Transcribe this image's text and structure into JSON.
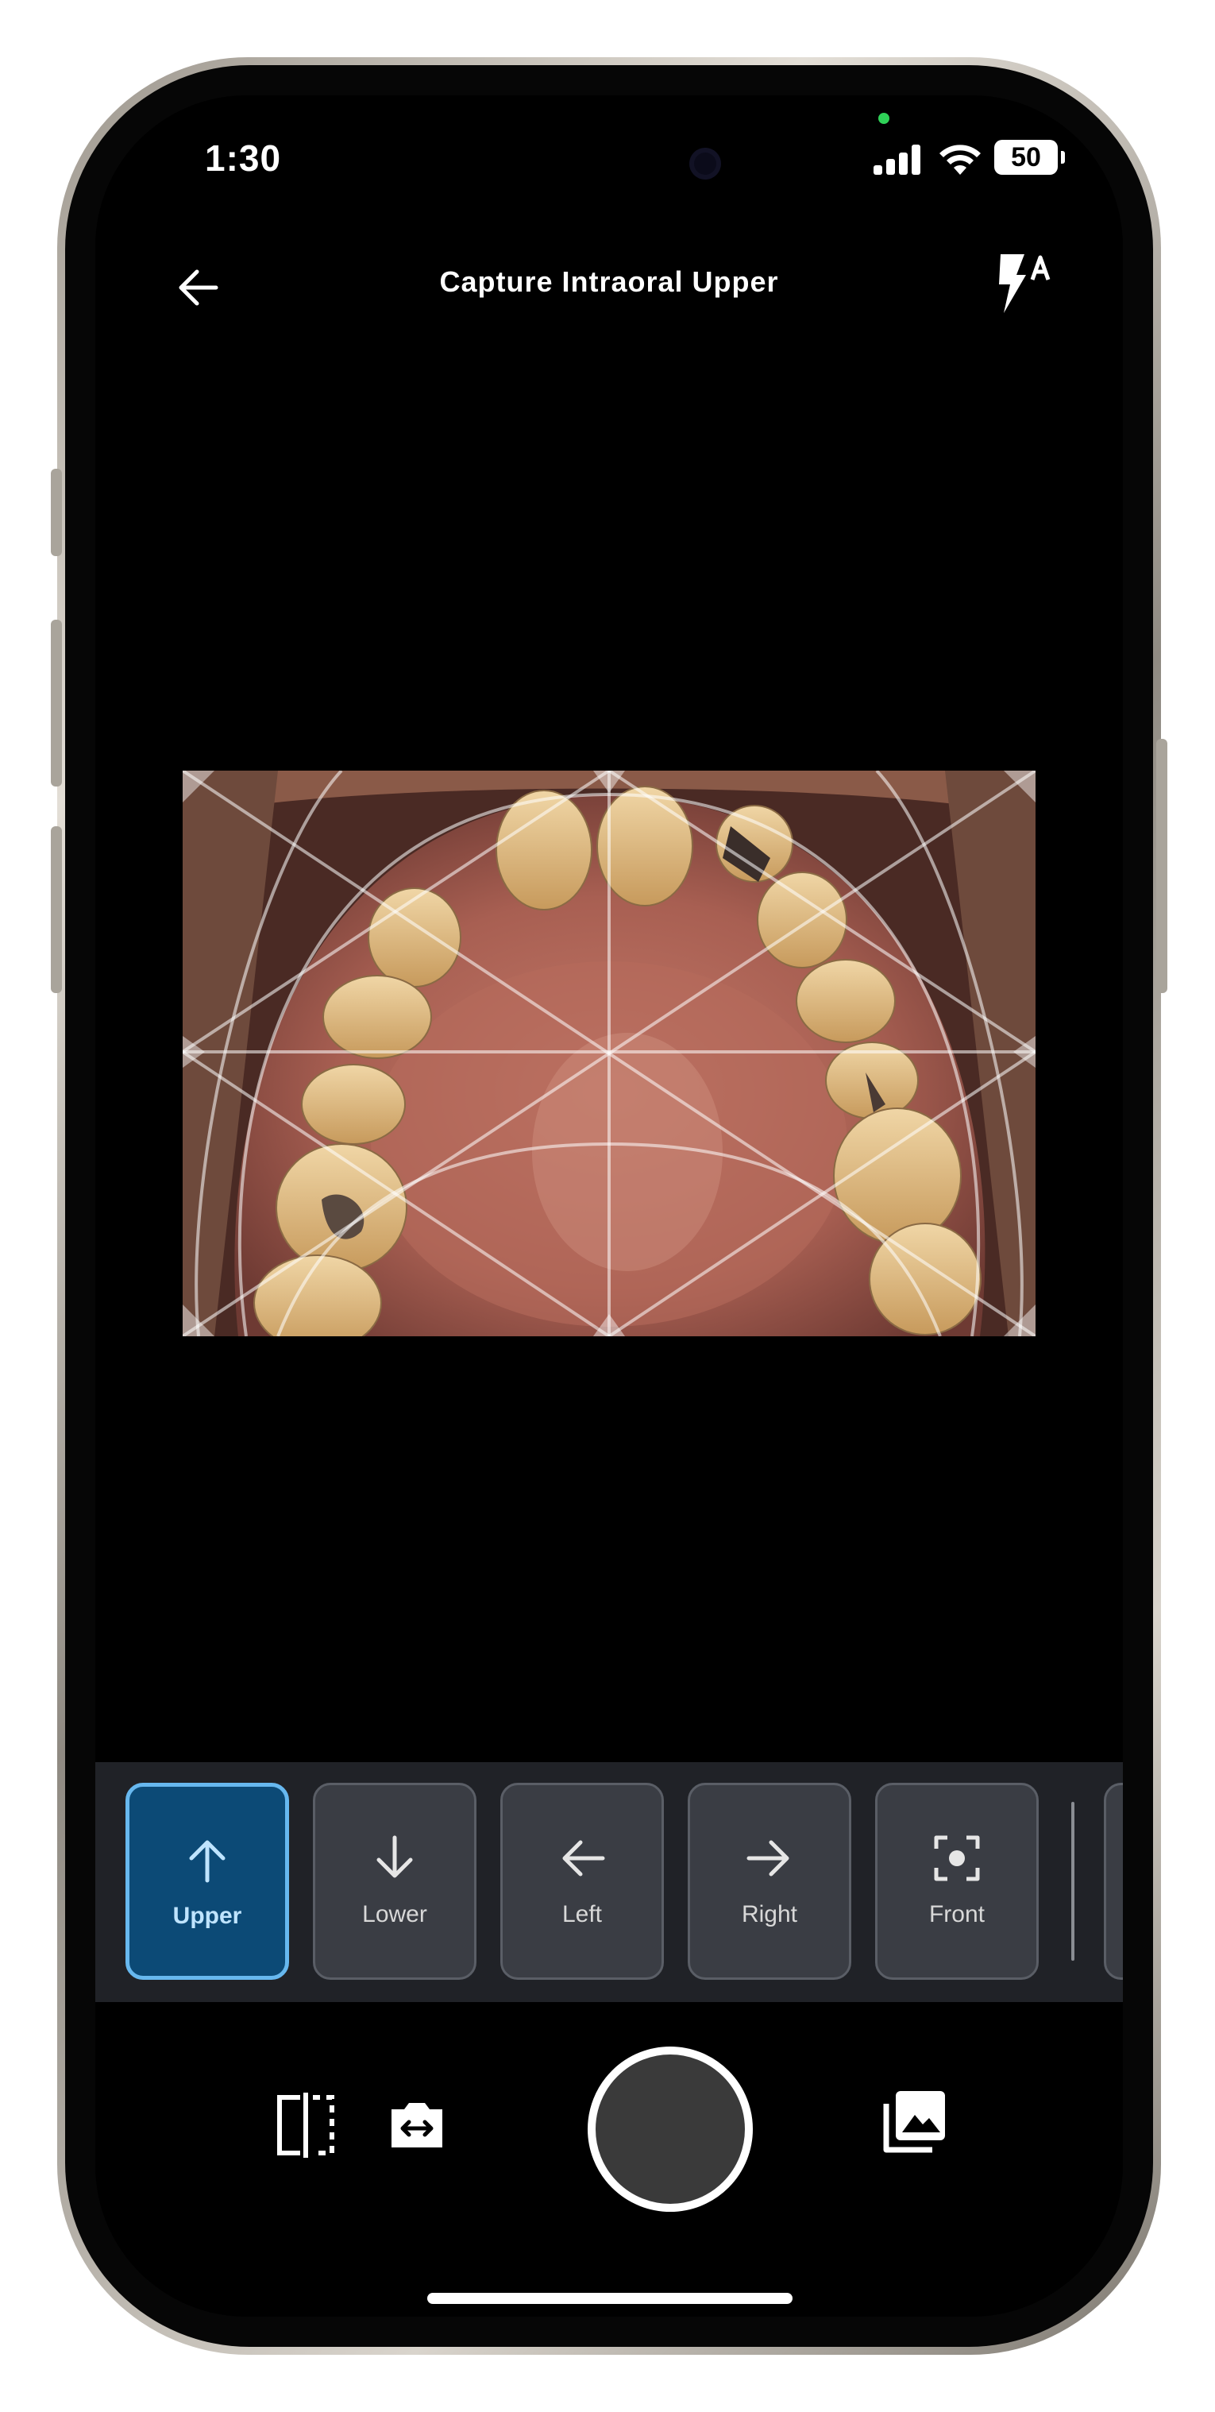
{
  "status_bar": {
    "time": "1:30",
    "battery": "50"
  },
  "header": {
    "title": "Capture Intraoral Upper"
  },
  "icons": {
    "back": "arrow-left-icon",
    "flash": "flash-auto-icon",
    "mirror": "flip-mirror-icon",
    "switch_camera": "switch-camera-icon",
    "gallery": "gallery-icon"
  },
  "views": [
    {
      "label": "Upper",
      "icon": "arrow-up-icon",
      "selected": true
    },
    {
      "label": "Lower",
      "icon": "arrow-down-icon",
      "selected": false
    },
    {
      "label": "Left",
      "icon": "arrow-left-icon",
      "selected": false
    },
    {
      "label": "Right",
      "icon": "arrow-right-icon",
      "selected": false
    },
    {
      "label": "Front",
      "icon": "focus-center-icon",
      "selected": false
    }
  ],
  "colors": {
    "accent_active_bg": "#0c4a76",
    "accent_active_border": "#67b8ef",
    "chip_bg": "#3a3d44",
    "selector_bg": "#202227"
  }
}
